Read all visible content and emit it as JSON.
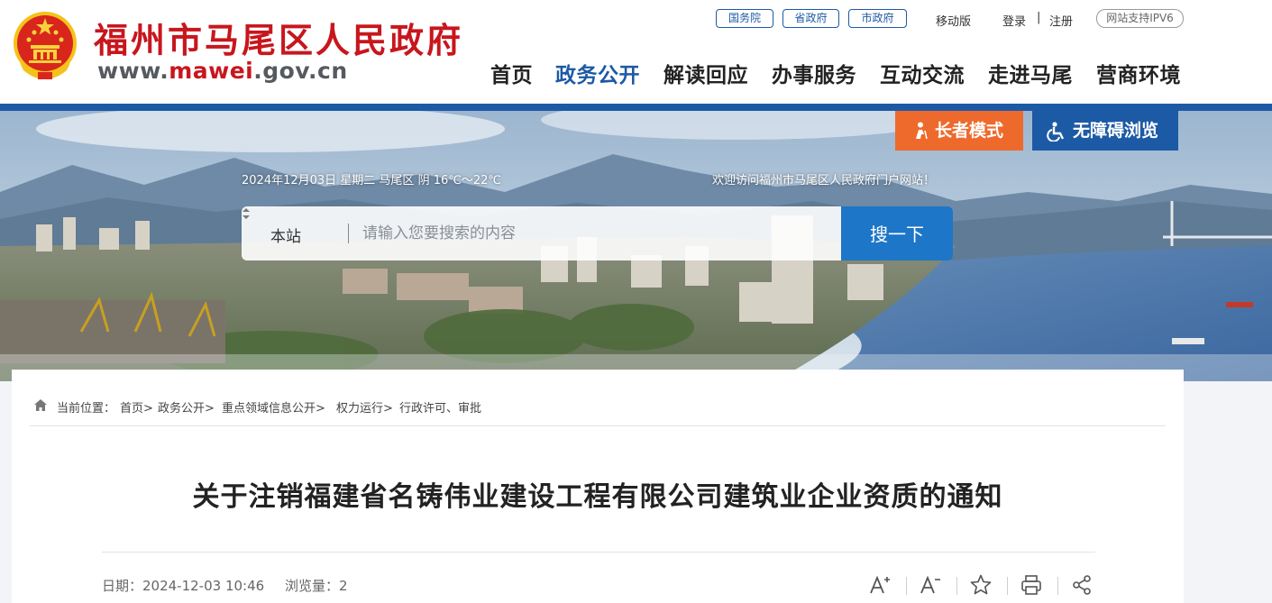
{
  "header": {
    "site_title": "福州市马尾区人民政府",
    "site_url_prefix": "www.",
    "site_url_accent": "mawei",
    "site_url_suffix": ".gov.cn",
    "top_links": {
      "guowuyuan": "国务院",
      "shengzhengfu": "省政府",
      "shizhengfu": "市政府",
      "mobile": "移动版",
      "login": "登录",
      "separator": "|",
      "register": "注册",
      "ipv6": "网站支持IPV6"
    },
    "nav": [
      "首页",
      "政务公开",
      "解读回应",
      "办事服务",
      "互动交流",
      "走进马尾",
      "营商环境"
    ],
    "active_nav": "政务公开"
  },
  "banner": {
    "elder_mode": "长者模式",
    "accessible": "无障碍浏览",
    "date_weather": "2024年12月03日 星期二 马尾区 阴 16℃～22℃",
    "welcome": "欢迎访问福州市马尾区人民政府门户网站！",
    "search": {
      "scope": "本站",
      "placeholder": "请输入您要搜索的内容",
      "button": "搜一下"
    }
  },
  "breadcrumb": {
    "label": "当前位置：",
    "items": [
      "首页>",
      "政务公开>",
      "重点领域信息公开>",
      "权力运行>",
      "行政许可、审批"
    ]
  },
  "article": {
    "title": "关于注销福建省名铸伟业建设工程有限公司建筑业企业资质的通知",
    "date": "日期：2024-12-03 10:46",
    "views": "浏览量：2"
  },
  "tools": [
    "font-increase-icon",
    "font-decrease-icon",
    "favorite-star-icon",
    "print-icon",
    "share-icon"
  ],
  "colors": {
    "brand_red": "#c8161d",
    "brand_blue": "#1d5aa5",
    "elder_orange": "#ee6a2c",
    "search_blue": "#1d76c7"
  }
}
